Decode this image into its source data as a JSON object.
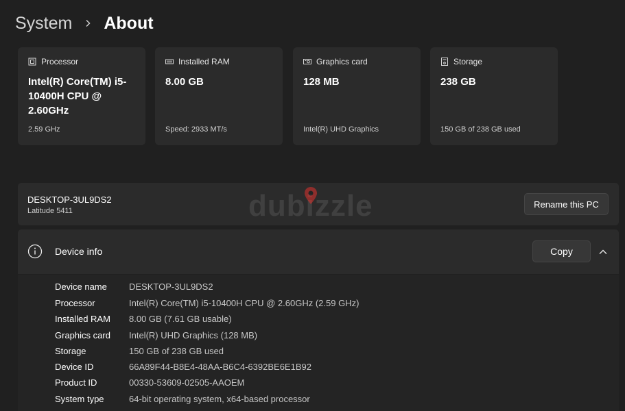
{
  "breadcrumb": {
    "parent": "System",
    "current": "About"
  },
  "specs": [
    {
      "icon": "processor-icon",
      "title": "Processor",
      "value": "Intel(R) Core(TM) i5-10400H CPU @ 2.60GHz",
      "sub": "2.59 GHz"
    },
    {
      "icon": "ram-icon",
      "title": "Installed RAM",
      "value": "8.00 GB",
      "sub": "Speed: 2933 MT/s"
    },
    {
      "icon": "graphics-card-icon",
      "title": "Graphics card",
      "value": "128 MB",
      "sub": "Intel(R) UHD Graphics"
    },
    {
      "icon": "storage-icon",
      "title": "Storage",
      "value": "238 GB",
      "sub": "150 GB of 238 GB used"
    }
  ],
  "pc": {
    "name": "DESKTOP-3UL9DS2",
    "model": "Latitude 5411",
    "rename_label": "Rename this PC"
  },
  "device_info": {
    "title": "Device info",
    "copy_label": "Copy",
    "rows": [
      {
        "label": "Device name",
        "value": "DESKTOP-3UL9DS2"
      },
      {
        "label": "Processor",
        "value": "Intel(R) Core(TM) i5-10400H CPU @ 2.60GHz (2.59 GHz)"
      },
      {
        "label": "Installed RAM",
        "value": "8.00 GB (7.61 GB usable)"
      },
      {
        "label": "Graphics card",
        "value": "Intel(R) UHD Graphics (128 MB)"
      },
      {
        "label": "Storage",
        "value": "150 GB of 238 GB used"
      },
      {
        "label": "Device ID",
        "value": "66A89F44-B8E4-48AA-B6C4-6392BE6E1B92"
      },
      {
        "label": "Product ID",
        "value": "00330-53609-02505-AAOEM"
      },
      {
        "label": "System type",
        "value": "64-bit operating system, x64-based processor"
      }
    ]
  },
  "watermark": {
    "text": "dubizzle",
    "pin_color": "#e0322d"
  }
}
